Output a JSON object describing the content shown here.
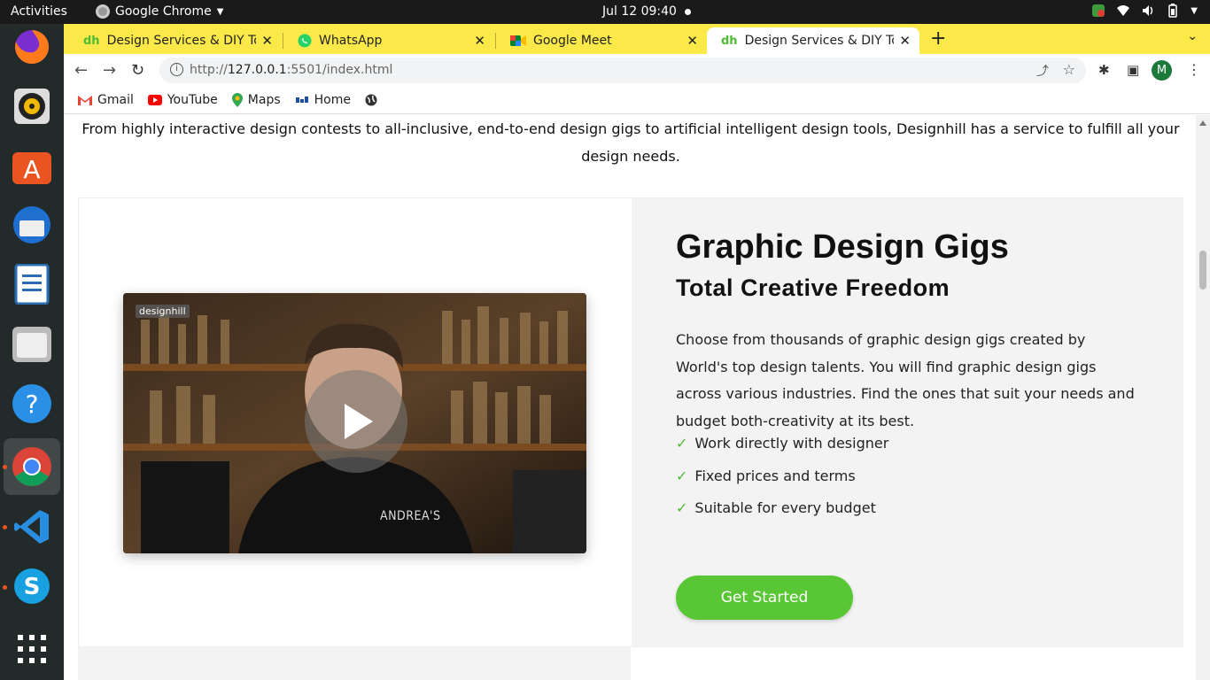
{
  "system": {
    "activities": "Activities",
    "app_name": "Google Chrome",
    "clock": "Jul 12  09:40"
  },
  "tabs": [
    {
      "title": "Design Services & DIY Too",
      "icon": "designhill-favicon"
    },
    {
      "title": "WhatsApp",
      "icon": "whatsapp-icon"
    },
    {
      "title": "Google Meet",
      "icon": "google-meet-icon"
    },
    {
      "title": "Design Services & DIY Too",
      "icon": "designhill-favicon",
      "active": true
    }
  ],
  "toolbar": {
    "url_prefix": "http://",
    "url_host": "127.0.0.1",
    "url_rest": ":5501/index.html",
    "avatar_initial": "M"
  },
  "bookmarks": [
    {
      "label": "Gmail",
      "icon": "gmail-icon"
    },
    {
      "label": "YouTube",
      "icon": "youtube-icon"
    },
    {
      "label": "Maps",
      "icon": "maps-icon"
    },
    {
      "label": "Home",
      "icon": "home-favicon"
    }
  ],
  "page": {
    "intro": "From highly interactive design contests to all-inclusive, end-to-end design gigs to artificial intelligent design tools, Designhill has a service to fulfill all your design needs.",
    "video": {
      "logo": "designhill",
      "shirt_text": "ANDREA'S"
    },
    "title": "Graphic Design Gigs",
    "subtitle": "Total Creative Freedom",
    "description": "Choose from thousands of graphic design gigs created by World's top design talents. You will find graphic design gigs across various industries. Find the ones that suit your needs and budget both-creativity at its best.",
    "features": [
      "Work directly with designer",
      "Fixed prices and terms",
      "Suitable for every budget"
    ],
    "cta": "Get Started"
  },
  "colors": {
    "tabstrip": "#fbe94a",
    "accent_green": "#59c735",
    "check_green": "#4fbb34"
  }
}
